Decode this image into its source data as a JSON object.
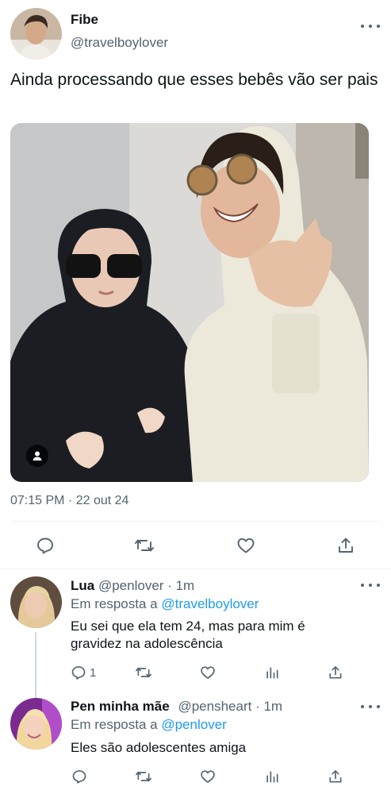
{
  "main_tweet": {
    "author_name": "Fibe",
    "author_handle": "@travelboylover",
    "text": "Ainda processando que esses bebês vão ser pais",
    "timestamp": "07:15 PM · 22 out 24",
    "actions": [
      "reply-icon",
      "retweet-icon",
      "like-icon",
      "share-icon"
    ]
  },
  "replies": [
    {
      "author_name": "Lua",
      "author_handle": "@penlover",
      "time": "· 1m",
      "reply_prefix": "Em resposta a",
      "reply_to": "@travelboylover",
      "text": "Eu sei que ela tem 24, mas para mim é gravidez na adolescência",
      "reply_count": "1"
    },
    {
      "author_name": "Pen minha mãe",
      "author_handle": "@pensheart",
      "time": "· 1m",
      "reply_prefix": "Em resposta a",
      "reply_to": "@penlover",
      "text": "Eles são adolescentes amiga"
    }
  ],
  "colors": {
    "text": "#0f1419",
    "secondary": "#536471",
    "link": "#1d9bf0",
    "divider": "#eff3f4"
  }
}
